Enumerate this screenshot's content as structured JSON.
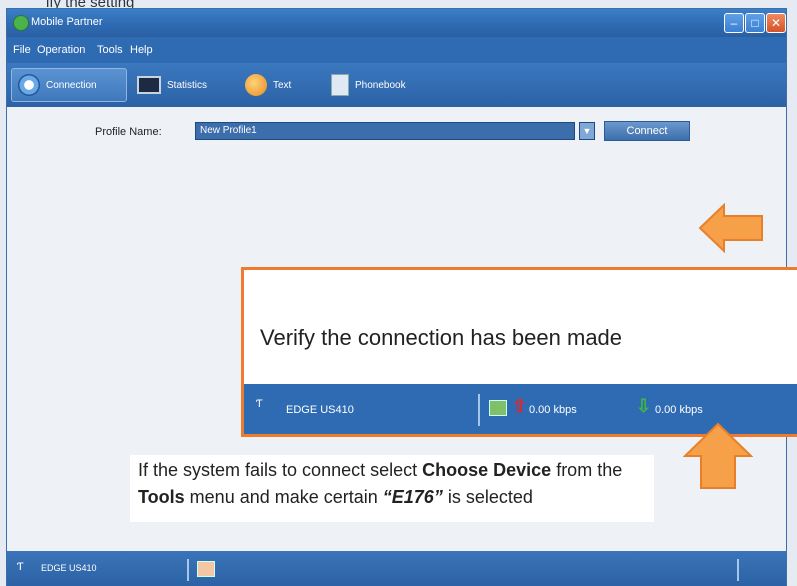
{
  "header_text": "ify the setting",
  "window": {
    "title": "Mobile Partner"
  },
  "menu": [
    "File",
    "Operation",
    "Tools",
    "Help"
  ],
  "toolbar": {
    "items": [
      {
        "label": "Connection",
        "icon": "connection-icon"
      },
      {
        "label": "Statistics",
        "icon": "statistics-icon"
      },
      {
        "label": "Text",
        "icon": "text-icon"
      },
      {
        "label": "Phonebook",
        "icon": "phonebook-icon"
      }
    ]
  },
  "profile": {
    "label": "Profile Name:",
    "value": "New Profile1",
    "connect_label": "Connect"
  },
  "callout": {
    "text": "Verify the connection has been made",
    "status": {
      "network": "EDGE US410",
      "upload": "0.00 kbps",
      "download": "0.00 kbps"
    }
  },
  "note": {
    "part1": "If the system fails to connect select ",
    "bold1": "Choose Device",
    "part2": " from the ",
    "bold2": "Tools",
    "part3": " menu and make certain ",
    "italic1": "“E176”",
    "part4": " is selected"
  },
  "statusbar": {
    "network": "EDGE US410"
  },
  "colors": {
    "window_blue": "#2f6bb3",
    "callout_border": "#f07a2e",
    "arrow_orange": "#f7a04a"
  }
}
